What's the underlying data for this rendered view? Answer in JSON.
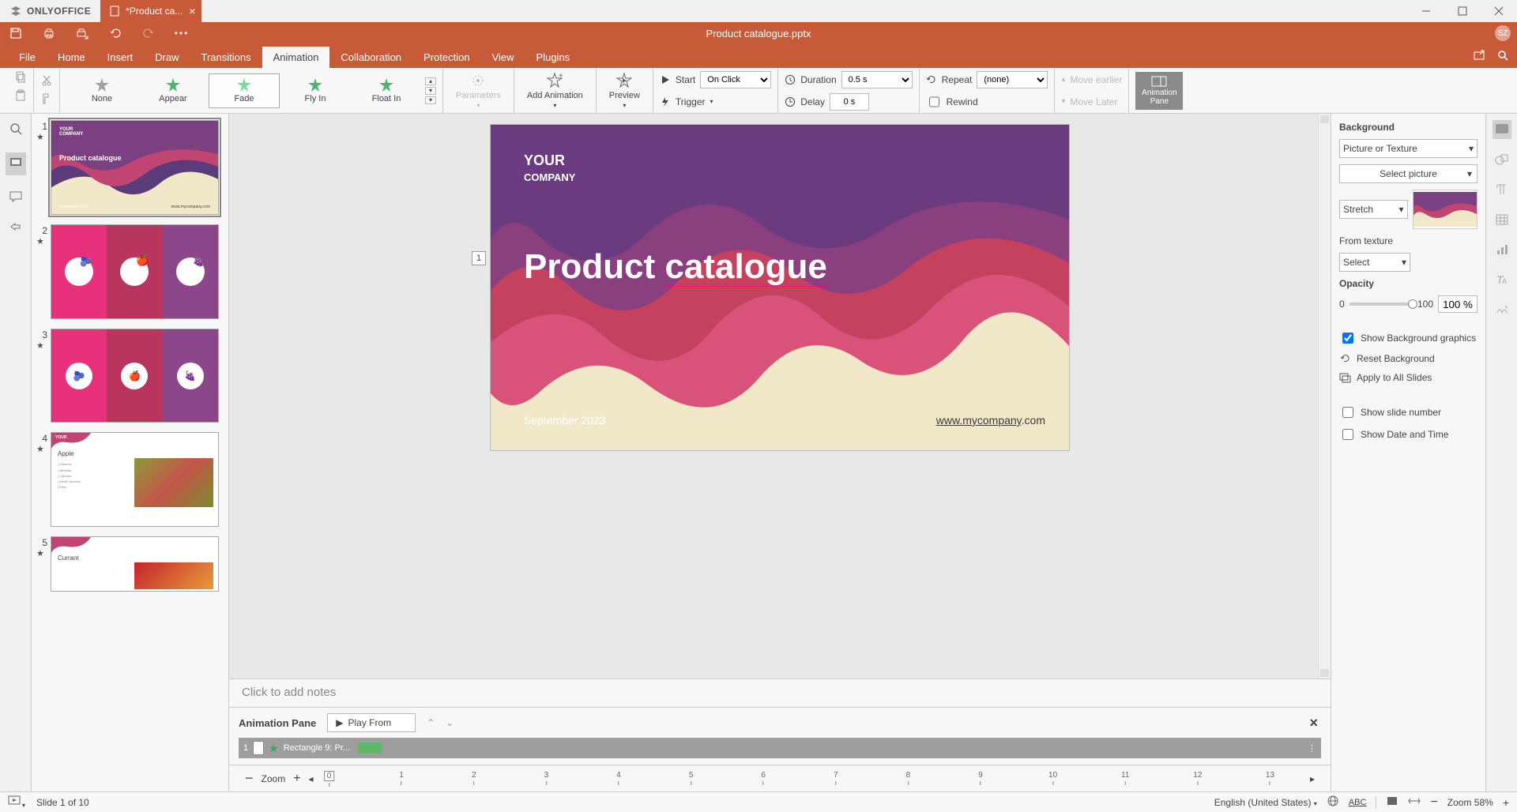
{
  "app": {
    "name": "ONLYOFFICE",
    "doc_tab": "*Product ca...",
    "doc_title": "Product catalogue.pptx",
    "avatar": "SZ"
  },
  "menus": {
    "items": [
      "File",
      "Home",
      "Insert",
      "Draw",
      "Transitions",
      "Animation",
      "Collaboration",
      "Protection",
      "View",
      "Plugins"
    ],
    "active": "Animation"
  },
  "ribbon": {
    "presets": [
      {
        "name": "None",
        "color": "#A0A0A0"
      },
      {
        "name": "Appear",
        "color": "#3DA35D"
      },
      {
        "name": "Fade",
        "color": "#3DA35D",
        "selected": true
      },
      {
        "name": "Fly In",
        "color": "#3DA35D"
      },
      {
        "name": "Float In",
        "color": "#3DA35D"
      }
    ],
    "parameters": "Parameters",
    "add_animation": "Add Animation",
    "preview": "Preview",
    "start_label": "Start",
    "start_value": "On Click",
    "trigger": "Trigger",
    "duration_label": "Duration",
    "duration_value": "0.5 s",
    "delay_label": "Delay",
    "delay_value": "0 s",
    "repeat_label": "Repeat",
    "repeat_value": "(none)",
    "rewind": "Rewind",
    "move_earlier": "Move earlier",
    "move_later": "Move Later",
    "anim_pane_btn": "Animation Pane"
  },
  "slide": {
    "company1": "YOUR",
    "company2": "COMPANY",
    "title": "Product catalogue",
    "date": "September 2023",
    "url_mid": "www.mycompany",
    "url_suffix": ".com",
    "index": "1"
  },
  "thumbs": [
    {
      "n": "1",
      "type": "title"
    },
    {
      "n": "2",
      "type": "fruits3"
    },
    {
      "n": "3",
      "type": "fruits3b"
    },
    {
      "n": "4",
      "type": "detail",
      "label": "Apple"
    },
    {
      "n": "5",
      "type": "detail",
      "label": "Currant"
    }
  ],
  "notes": {
    "placeholder": "Click to add notes"
  },
  "anim_pane": {
    "title": "Animation Pane",
    "play_from": "Play From",
    "item_index": "1",
    "item_name": "Rectangle 9: Pr..."
  },
  "ruler": {
    "zoom_label": "Zoom",
    "ticks": [
      "0",
      "1",
      "2",
      "3",
      "4",
      "5",
      "6",
      "7",
      "8",
      "9",
      "10",
      "11",
      "12",
      "13"
    ]
  },
  "right": {
    "bg_label": "Background",
    "bg_fill": "Picture or Texture",
    "select_pic": "Select picture",
    "fit": "Stretch",
    "from_texture": "From texture",
    "texture_sel": "Select",
    "opacity_label": "Opacity",
    "opacity_min": "0",
    "opacity_max": "100",
    "opacity_val": "100 %",
    "show_bg": "Show Background graphics",
    "reset": "Reset Background",
    "apply_all": "Apply to All Slides",
    "show_num": "Show slide number",
    "show_date": "Show Date and Time"
  },
  "status": {
    "slide": "Slide 1 of 10",
    "lang": "English (United States)",
    "zoom": "Zoom 58%"
  }
}
